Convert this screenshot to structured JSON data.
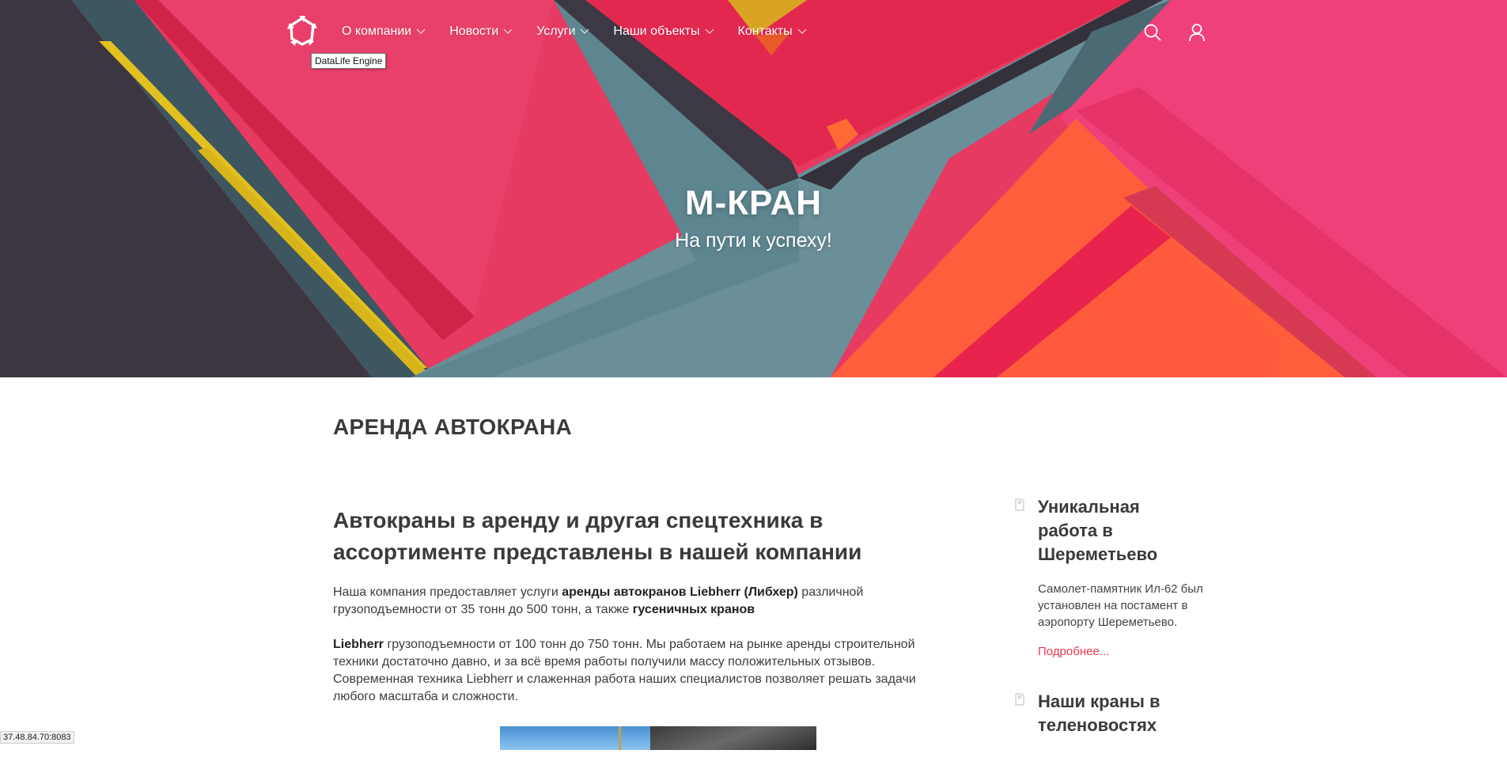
{
  "header": {
    "logo_name": "star-logo",
    "tooltip": "DataLife Engine",
    "menu": [
      {
        "label": "О компании"
      },
      {
        "label": "Новости"
      },
      {
        "label": "Услуги"
      },
      {
        "label": "Наши объекты"
      },
      {
        "label": "Контакты"
      }
    ],
    "tools": [
      "search-icon",
      "user-icon"
    ]
  },
  "hero": {
    "title": "М-КРАН",
    "subtitle": "На пути к успеху!"
  },
  "page": {
    "heading": "АРЕНДА АВТОКРАНА"
  },
  "article": {
    "title": "Автокраны в аренду и другая спецтехника в ассортименте представлены в нашей компании",
    "p1_a": "Наша компания предоставляет услуги ",
    "p1_b": "аренды автокранов Liebherr (Либхер)",
    "p1_c": " различной грузоподъемности от 35 тонн до 500 тонн, а также ",
    "p1_d": "гусеничных кранов",
    "p2_a": "Liebherr",
    "p2_b": " грузоподъемности от 100 тонн до 750 тонн. Мы работаем на рынке аренды строительной техники достаточно давно, и за всё время работы получили массу положительных отзывов. Современная техника Liebherr и слаженная работа наших специалистов позволяет решать задачи любого масштаба и сложности."
  },
  "sidebar": {
    "items": [
      {
        "title": "Уникальная работа в Шереметьево",
        "text": "Самолет-памятник Ил-62 был установлен на постамент в аэропорту Шереметьево.",
        "more": "Подробнее..."
      },
      {
        "title": "Наши краны в теленовостях"
      }
    ]
  },
  "status": {
    "url": "37.48.84.70:8083"
  },
  "colors": {
    "accent": "#e8384f",
    "hero_pink": "#e8335f",
    "hero_teal": "#5f8791",
    "hero_orange": "#ff5a3c",
    "hero_dark": "#3a3540",
    "hero_yellow": "#e5c21f"
  }
}
